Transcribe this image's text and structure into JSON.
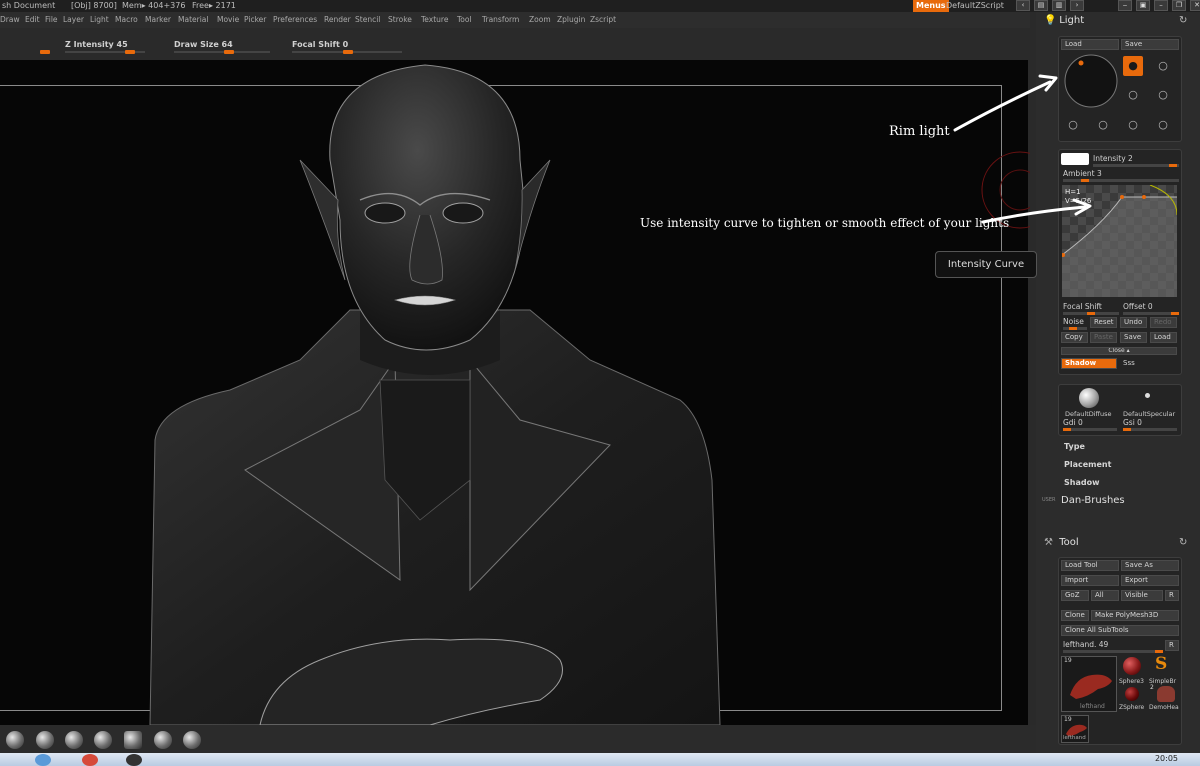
{
  "titlebar": {
    "doc": "sh Document",
    "obj": "[Obj] 8700]",
    "mem": "Mem▸ 404+376",
    "free": "Free▸ 2171",
    "menus_btn": "Menus",
    "script": "DefaultZScript"
  },
  "menu": [
    "Draw",
    "Edit",
    "File",
    "Layer",
    "Light",
    "Macro",
    "Marker",
    "Material",
    "Movie",
    "Picker",
    "Preferences",
    "Render",
    "Stencil",
    "Stroke",
    "Texture",
    "Tool",
    "Transform",
    "Zoom",
    "Zplugin",
    "Zscript"
  ],
  "sliders": {
    "z_intensity": "Z Intensity 45",
    "draw_size": "Draw Size 64",
    "focal_shift": "Focal Shift 0"
  },
  "light": {
    "title": "Light",
    "load": "Load",
    "save": "Save",
    "intensity": "Intensity 2",
    "ambient": "Ambient 3",
    "curve_h": "H=1",
    "curve_v": "V=5/26",
    "focal_shift": "Focal Shift",
    "offset": "Offset 0",
    "noise": "Noise",
    "reset": "Reset",
    "undo": "Undo",
    "redo": "Redo",
    "copy": "Copy",
    "paste": "Paste",
    "csave": "Save",
    "cload": "Load",
    "close": "Close ▴",
    "shadow_btn": "Shadow",
    "sss": "Sss",
    "diffuse": "DefaultDiffuse",
    "specular": "DefaultSpecular",
    "gdi": "Gdi 0",
    "gsi": "Gsi 0",
    "type": "Type",
    "placement": "Placement",
    "shadow": "Shadow"
  },
  "user": {
    "tag": "USER",
    "title": "Dan-Brushes"
  },
  "tool": {
    "title": "Tool",
    "load_tool": "Load Tool",
    "save_as": "Save As",
    "import": "Import",
    "export": "Export",
    "goz": "GoZ",
    "all": "All",
    "visible": "Visible",
    "r": "R",
    "clone": "Clone",
    "make_polymesh": "Make PolyMesh3D",
    "clone_all": "Clone All SubTools",
    "current": "lefthand. 49",
    "thumb_count1": "19",
    "thumb_lefthand": "lefthand",
    "sphere3": "Sphere3",
    "simplebr": "SimpleBr",
    "zsphere": "ZSphere",
    "demohe": "DemoHea",
    "count2": "2",
    "thumb_count2": "19",
    "thumb_lefthand2": "lefthand"
  },
  "annotations": {
    "rim_light": "Rim light",
    "curve_note": "Use intensity curve to tighten  or smooth effect of your lights",
    "tooltip": "Intensity Curve"
  },
  "taskbar": {
    "clock": "20:05"
  },
  "colors": {
    "accent": "#e86a0c",
    "panel": "#2c2c2c",
    "canvas": "#060606"
  }
}
